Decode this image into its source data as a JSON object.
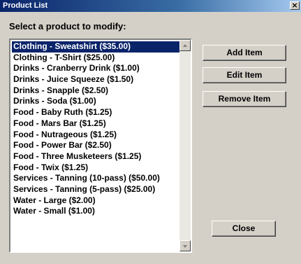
{
  "window": {
    "title": "Product List",
    "close_glyph": "×"
  },
  "prompt": "Select a product to modify:",
  "products": [
    "Clothing - Sweatshirt ($35.00)",
    "Clothing - T-Shirt ($25.00)",
    "Drinks - Cranberry Drink ($1.00)",
    "Drinks - Juice Squeeze ($1.50)",
    "Drinks - Snapple ($2.50)",
    "Drinks - Soda ($1.00)",
    "Food - Baby Ruth ($1.25)",
    "Food - Mars Bar ($1.25)",
    "Food - Nutrageous ($1.25)",
    "Food - Power Bar ($2.50)",
    "Food - Three Musketeers ($1.25)",
    "Food - Twix ($1.25)",
    "Services - Tanning (10-pass) ($50.00)",
    "Services - Tanning (5-pass) ($25.00)",
    "Water - Large ($2.00)",
    "Water - Small ($1.00)"
  ],
  "selected_index": 0,
  "buttons": {
    "add": "Add Item",
    "edit": "Edit Item",
    "remove": "Remove Item",
    "close": "Close"
  },
  "colors": {
    "selection": "#0a246a",
    "title_bar": "#0a246a",
    "face": "#d4d0c8"
  }
}
